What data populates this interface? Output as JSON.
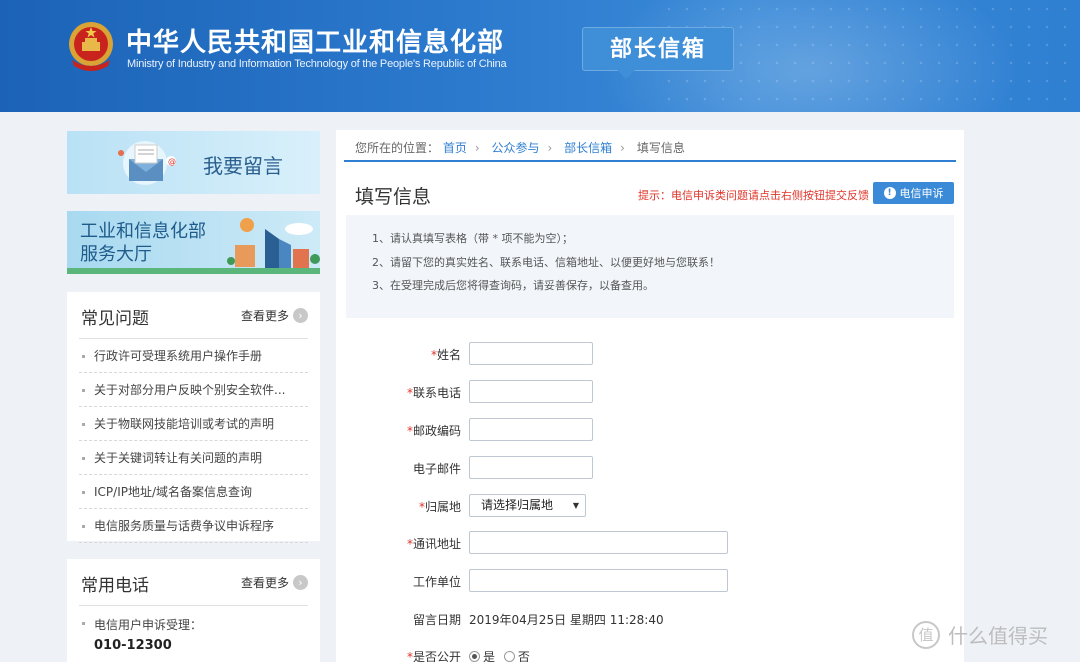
{
  "header": {
    "title": "中华人民共和国工业和信息化部",
    "subtitle": "Ministry of Industry and Information Technology of the People's Republic of China",
    "badge": "部长信箱"
  },
  "sidebar": {
    "banner_message": "我要留言",
    "banner_hall_line1": "工业和信息化部",
    "banner_hall_line2": "服务大厅",
    "faq": {
      "title": "常见问题",
      "more": "查看更多",
      "items": [
        "行政许可受理系统用户操作手册",
        "关于对部分用户反映个别安全软件...",
        "关于物联网技能培训或考试的声明",
        "关于关键词转让有关问题的声明",
        "ICP/IP地址/域名备案信息查询",
        "电信服务质量与话费争议申诉程序"
      ]
    },
    "phones": {
      "title": "常用电话",
      "more": "查看更多",
      "item_label": "电信用户申诉受理：",
      "item_number": "010-12300"
    }
  },
  "breadcrumb": {
    "prefix": "您所在的位置：",
    "items": [
      "首页",
      "公众参与",
      "部长信箱",
      "填写信息"
    ]
  },
  "form": {
    "title": "填写信息",
    "hint": "提示：电信申诉类问题请点击右侧按钮提交反馈",
    "complain_button": "电信申诉",
    "notices": [
      "1、请认真填写表格（带 * 项不能为空）；",
      "2、请留下您的真实姓名、联系电话、信箱地址、以便更好地与您联系！",
      "3、在受理完成后您将得查询码，请妥善保存，以备查用。"
    ],
    "required_mark": "*",
    "fields": {
      "name": "姓名",
      "phone": "联系电话",
      "postcode": "邮政编码",
      "email": "电子邮件",
      "region": "归属地",
      "region_value": "请选择归属地",
      "address": "通讯地址",
      "employer": "工作单位",
      "date": "留言日期",
      "date_value": "2019年04月25日 星期四 11:28:40",
      "public": "是否公开",
      "public_yes": "是",
      "public_no": "否"
    }
  },
  "watermark": "什么值得买",
  "colors": {
    "accent": "#2f7fd2",
    "required": "#e0342a",
    "header": "#2a78cc"
  }
}
